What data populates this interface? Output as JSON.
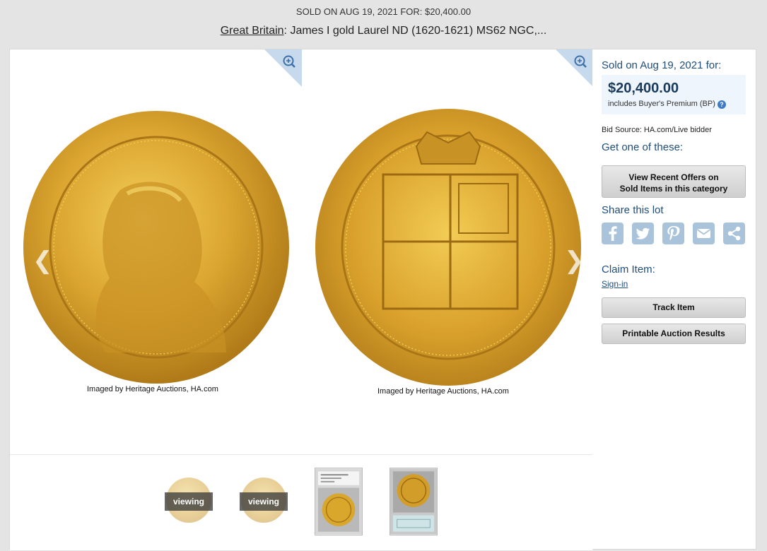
{
  "header": {
    "sold_line": "SOLD ON AUG 19, 2021 FOR: $20,400.00",
    "category_link": "Great Britain",
    "title_rest": ": James I gold Laurel ND (1620-1621) MS62 NGC,..."
  },
  "viewer": {
    "caption_left": "Imaged by Heritage Auctions, HA.com",
    "caption_right": "Imaged by Heritage Auctions, HA.com",
    "prev_icon": "chevron-left-icon",
    "next_icon": "chevron-right-icon",
    "zoom_icon": "zoom-in-icon",
    "thumbnails": [
      {
        "label": "viewing"
      },
      {
        "label": "viewing"
      }
    ]
  },
  "sidebar": {
    "sold_on": "Sold on Aug 19, 2021 for:",
    "price": "$20,400.00",
    "premium": "includes Buyer's Premium (BP)",
    "help_glyph": "?",
    "bid_source": "Bid Source: HA.com/Live bidder",
    "get_one": "Get one of these:",
    "offers_line1": "View Recent Offers on",
    "offers_line2": "Sold Items in this category",
    "share_title": "Share this lot",
    "share_icons": [
      "facebook-icon",
      "twitter-icon",
      "pinterest-icon",
      "email-icon",
      "share-icon"
    ],
    "claim_title": "Claim Item:",
    "sign_in": "Sign-in",
    "track": "Track Item",
    "printable": "Printable Auction Results"
  },
  "colors": {
    "accent_blue": "#1f4d7a",
    "price_bg": "#eef5fc",
    "icon_blue": "#a9c3db",
    "gold": "#d9a72c"
  }
}
